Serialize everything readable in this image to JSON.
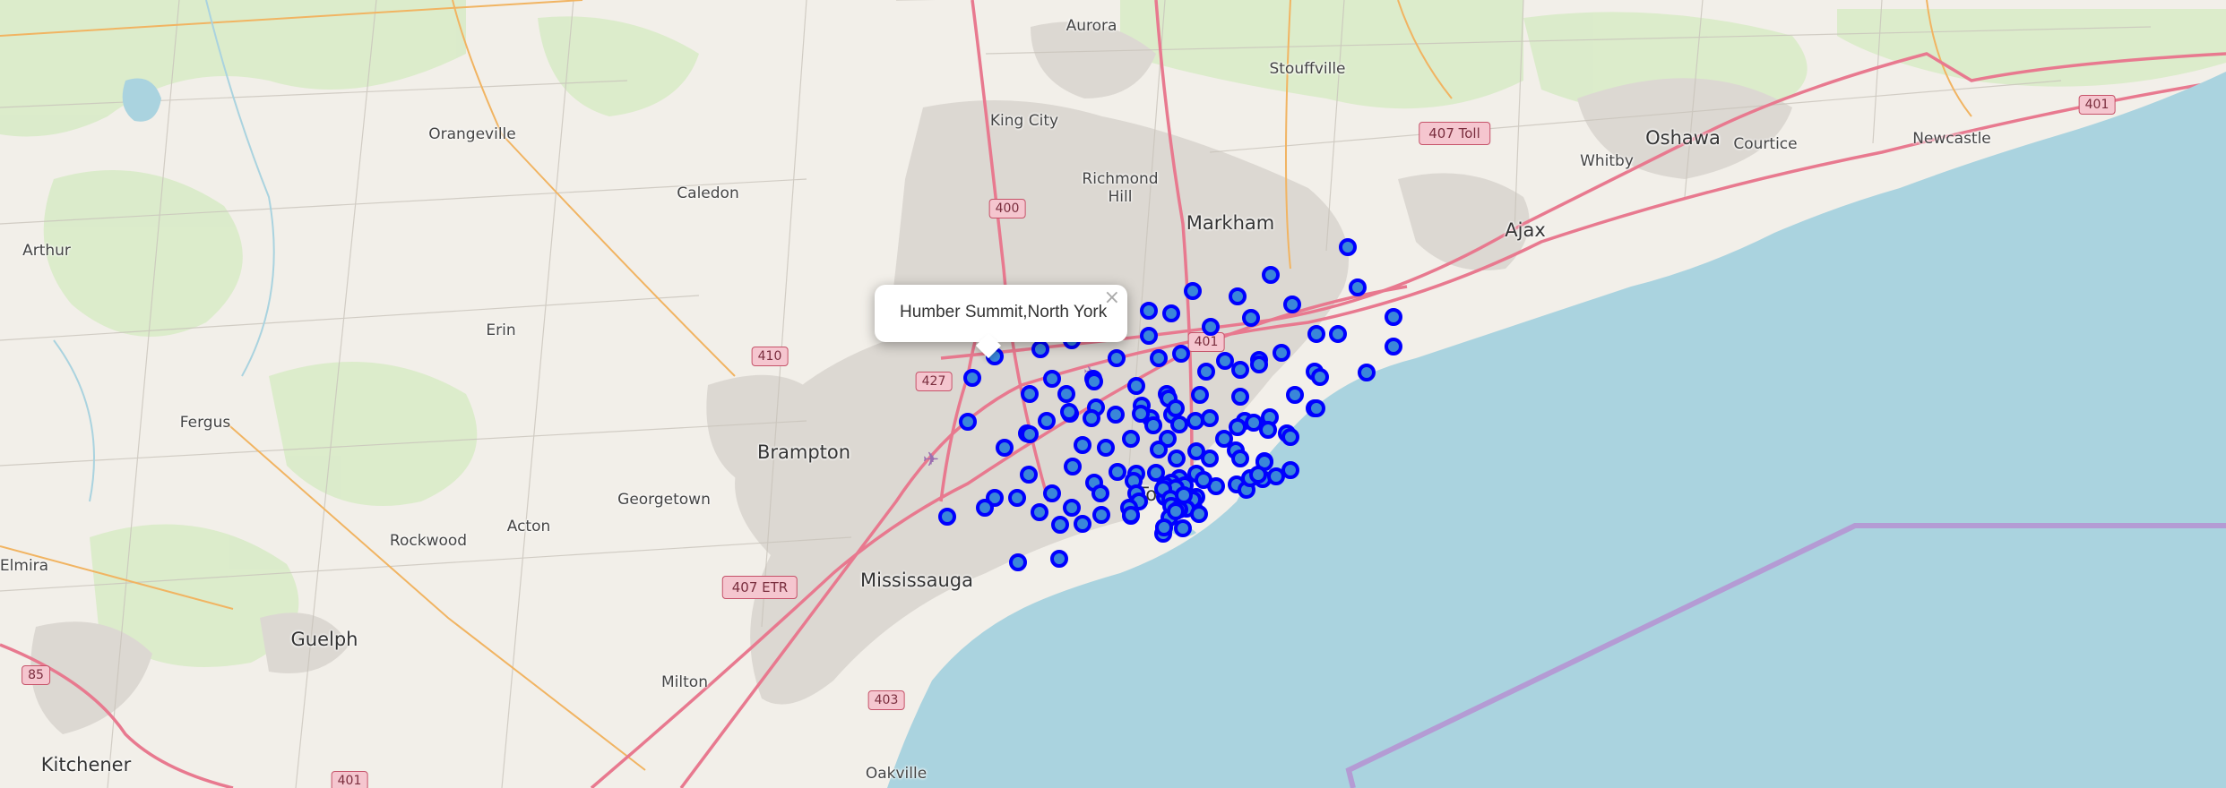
{
  "popup": {
    "title": "Humber Summit,North York",
    "close_symbol": "×"
  },
  "icons": {
    "airport": "airport-icon"
  },
  "place_labels": [
    {
      "key": "aurora",
      "text": "Aurora"
    },
    {
      "key": "stouffville",
      "text": "Stouffville"
    },
    {
      "key": "king_city",
      "text": "King City"
    },
    {
      "key": "orangeville",
      "text": "Orangeville"
    },
    {
      "key": "caledon",
      "text": "Caledon"
    },
    {
      "key": "richmond_hill",
      "text": "Richmond Hill"
    },
    {
      "key": "markham",
      "text": "Markham"
    },
    {
      "key": "whitby",
      "text": "Whitby"
    },
    {
      "key": "oshawa",
      "text": "Oshawa"
    },
    {
      "key": "courtice",
      "text": "Courtice"
    },
    {
      "key": "newcastle",
      "text": "Newcastle"
    },
    {
      "key": "ajax",
      "text": "Ajax"
    },
    {
      "key": "arthur",
      "text": "Arthur"
    },
    {
      "key": "erin",
      "text": "Erin"
    },
    {
      "key": "fergus",
      "text": "Fergus"
    },
    {
      "key": "brampton",
      "text": "Brampton"
    },
    {
      "key": "georgetown",
      "text": "Georgetown"
    },
    {
      "key": "rockwood",
      "text": "Rockwood"
    },
    {
      "key": "acton",
      "text": "Acton"
    },
    {
      "key": "elmira",
      "text": "Elmira"
    },
    {
      "key": "guelph",
      "text": "Guelph"
    },
    {
      "key": "mississauga",
      "text": "Mississauga"
    },
    {
      "key": "milton",
      "text": "Milton"
    },
    {
      "key": "kitchener",
      "text": "Kitchener"
    },
    {
      "key": "oakville",
      "text": "Oakville"
    },
    {
      "key": "toronto",
      "text": "To"
    }
  ],
  "highway_shields": [
    "400",
    "407 Toll",
    "401",
    "410",
    "427",
    "401",
    "407 ETR",
    "403",
    "85",
    "401"
  ],
  "colors": {
    "water": "#aad3df",
    "land": "#f2efe9",
    "marker_stroke": "#0000ff",
    "marker_fill": "#3a86d9",
    "boundary": "#b49bd4",
    "motorway": "#e8798f"
  }
}
